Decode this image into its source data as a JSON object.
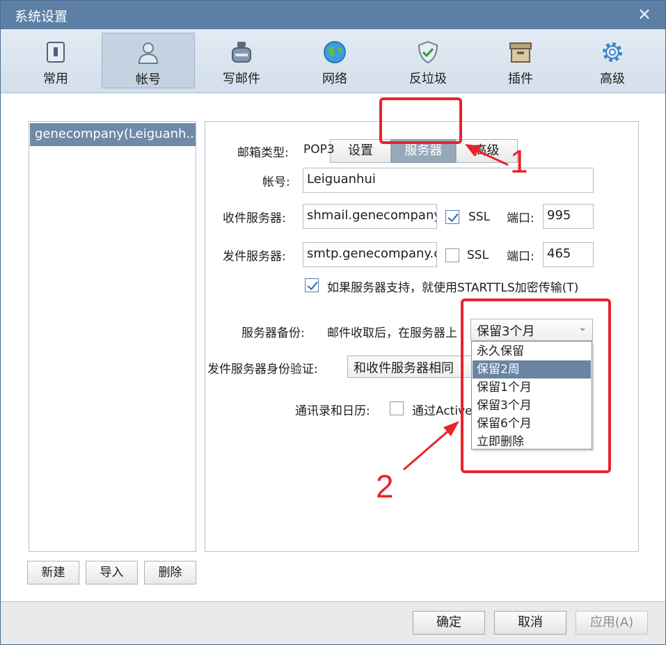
{
  "window": {
    "title": "系统设置",
    "close_icon": "close-icon"
  },
  "toolbar": {
    "items": [
      {
        "label": "常用",
        "icon": "switch-icon"
      },
      {
        "label": "帐号",
        "icon": "user-icon",
        "active": true
      },
      {
        "label": "写邮件",
        "icon": "inkwell-icon"
      },
      {
        "label": "网络",
        "icon": "globe-icon"
      },
      {
        "label": "反垃圾",
        "icon": "shield-icon"
      },
      {
        "label": "插件",
        "icon": "box-icon"
      },
      {
        "label": "高级",
        "icon": "gear-icon"
      }
    ]
  },
  "accounts": {
    "items": [
      "genecompany(Leiguanh..."
    ],
    "new_label": "新建",
    "import_label": "导入",
    "delete_label": "删除"
  },
  "tabs": [
    "设置",
    "服务器",
    "高级"
  ],
  "form": {
    "mailbox_type_label": "邮箱类型:",
    "mailbox_type_value": "POP3",
    "account_label": "帐号:",
    "account_value": "Leiguanhui",
    "incoming_label": "收件服务器:",
    "incoming_value": "shmail.genecompany",
    "incoming_ssl_label": "SSL",
    "incoming_ssl_checked": true,
    "incoming_port_label": "端口:",
    "incoming_port": "995",
    "outgoing_label": "发件服务器:",
    "outgoing_value": "smtp.genecompany.c",
    "outgoing_ssl_label": "SSL",
    "outgoing_ssl_checked": false,
    "outgoing_port_label": "端口:",
    "outgoing_port": "465",
    "starttls_label": "如果服务器支持，就使用STARTTLS加密传输(T)",
    "starttls_checked": true,
    "backup_label": "服务器备份:",
    "backup_desc": "邮件收取后，在服务器上",
    "backup_selected": "保留3个月",
    "backup_options": [
      "永久保留",
      "保留2周",
      "保留1个月",
      "保留3个月",
      "保留6个月",
      "立即删除"
    ],
    "backup_highlighted": "保留2周",
    "auth_label": "发件服务器身份验证:",
    "auth_value": "和收件服务器相同",
    "contacts_label": "通讯录和日历:",
    "contacts_option_label": "通过Active"
  },
  "footer": {
    "ok_label": "确定",
    "cancel_label": "取消",
    "apply_label": "应用(A)"
  },
  "annotations": {
    "marker1": "1",
    "marker2": "2",
    "color": "#e8232d"
  },
  "colors": {
    "titlebar": "#5d7fa5",
    "selection": "#6f89a8",
    "active_tab": "#98a8bb"
  }
}
